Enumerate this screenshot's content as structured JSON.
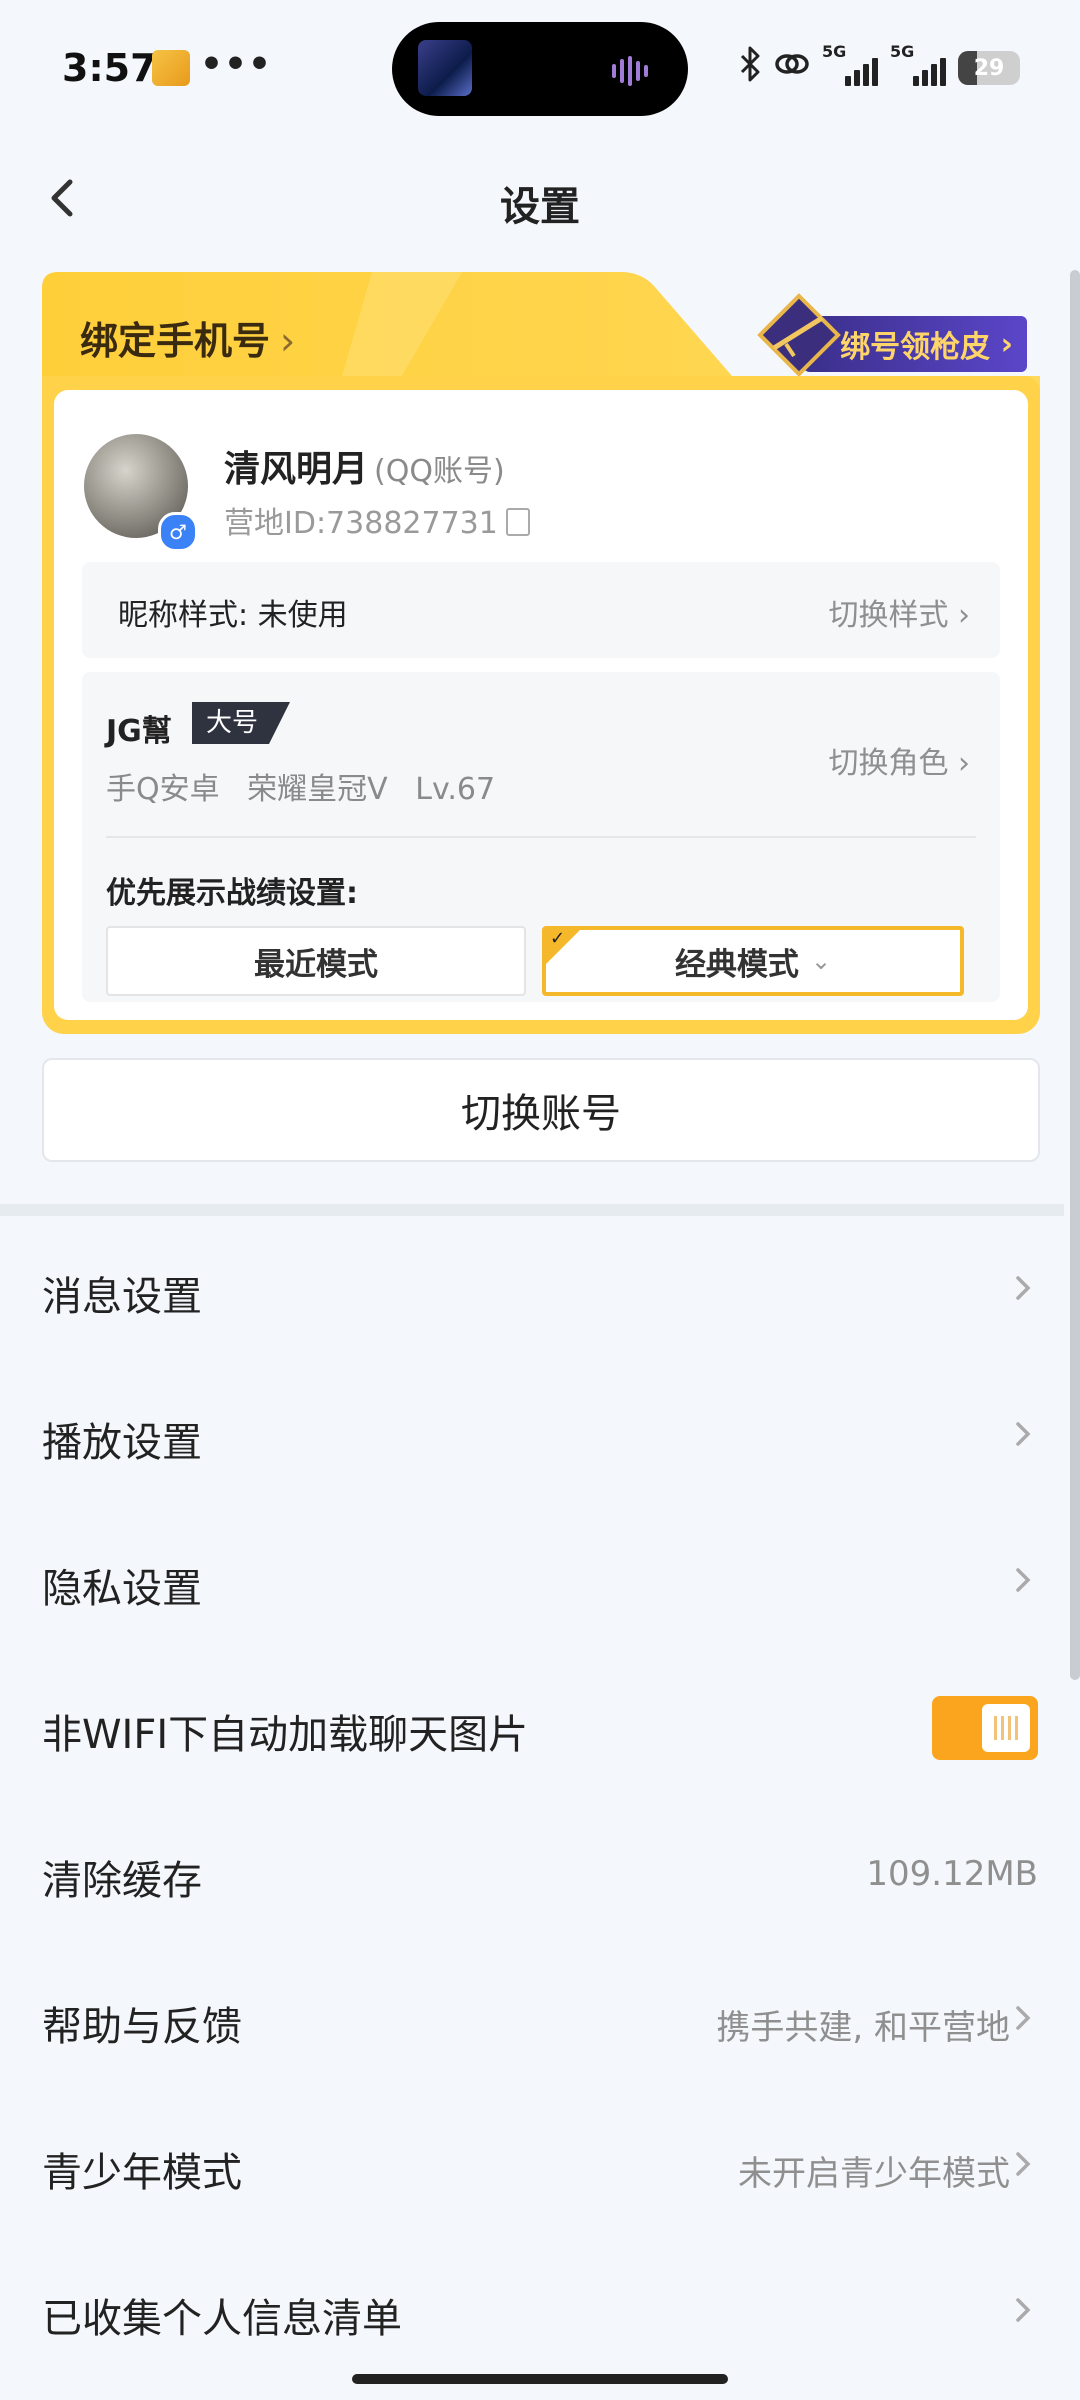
{
  "status_bar": {
    "time": "3:57",
    "more": "•••",
    "network_1": "5G",
    "network_2": "5G",
    "battery": "29",
    "icons": [
      "bluetooth-icon",
      "link-icon",
      "signal-icon",
      "battery-icon"
    ]
  },
  "nav": {
    "title": "设置"
  },
  "account_card": {
    "bind_phone": "绑定手机号",
    "skin_promo": "绑号领枪皮",
    "username": "清风明月",
    "account_type": "(QQ账号)",
    "camp_id": "营地ID:738827731",
    "nickname_style_label": "昵称样式: 未使用",
    "switch_style": "切换样式",
    "role": {
      "name": "JG幫",
      "tag": "大号",
      "platform": "手Q安卓",
      "rank": "荣耀皇冠Ⅴ",
      "level": "Lv.67",
      "switch_role": "切换角色"
    },
    "priority_label": "优先展示战绩设置:",
    "modes": [
      "最近模式",
      "经典模式"
    ],
    "selected_mode": "经典模式"
  },
  "switch_account": "切换账号",
  "settings": [
    {
      "label": "消息设置",
      "value": ""
    },
    {
      "label": "播放设置",
      "value": ""
    },
    {
      "label": "隐私设置",
      "value": ""
    },
    {
      "label": "非WIFI下自动加载聊天图片",
      "value": "",
      "toggle": true
    },
    {
      "label": "清除缓存",
      "value": "109.12MB"
    },
    {
      "label": "帮助与反馈",
      "value": "携手共建, 和平营地"
    },
    {
      "label": "青少年模式",
      "value": "未开启青少年模式"
    },
    {
      "label": "已收集个人信息清单",
      "value": ""
    }
  ],
  "colors": {
    "accent": "#fba51f",
    "card_yellow": "#ffd24a",
    "promo_purple": "#4a3bb0",
    "background": "#f4f7fb"
  }
}
